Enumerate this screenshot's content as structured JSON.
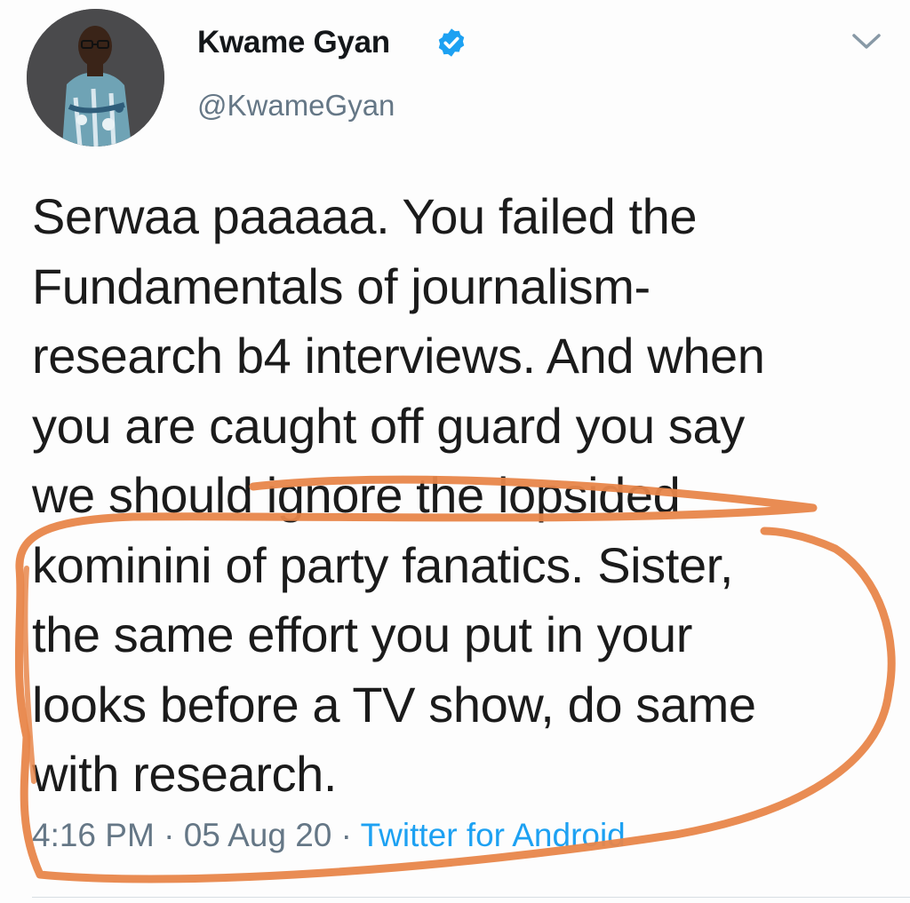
{
  "tweet": {
    "author": {
      "display_name": "Kwame Gyan",
      "handle": "@KwameGyan",
      "verified": true,
      "avatar_icon": "profile-photo"
    },
    "text": "Serwaa paaaaa. You failed the\nFundamentals of journalism-\nresearch b4 interviews. And when\nyou are caught off guard you say\nwe should ignore the lopsided\nkominini of party fanatics. Sister,\nthe same effort you put in your\nlooks before a TV show, do same\nwith research.",
    "time": "4:16 PM",
    "separator": " · ",
    "date": "05 Aug 20",
    "source": "Twitter for Android"
  },
  "annotation": {
    "type": "hand-drawn-circle",
    "color": "#e8864a"
  },
  "colors": {
    "text": "#14171a",
    "muted": "#657786",
    "link": "#1da1f2",
    "verified": "#1da1f2"
  }
}
